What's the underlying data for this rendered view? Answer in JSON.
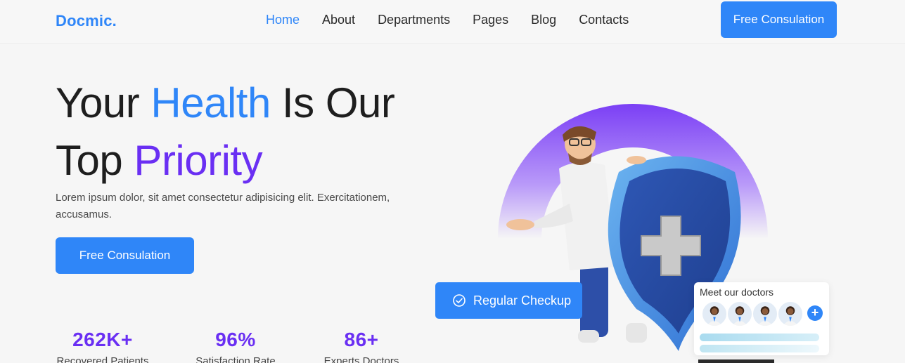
{
  "header": {
    "logo": "Docmic.",
    "nav": [
      "Home",
      "About",
      "Departments",
      "Pages",
      "Blog",
      "Contacts"
    ],
    "active_nav": "Home",
    "cta": "Free Consulation"
  },
  "hero": {
    "title_part1": "Your ",
    "title_highlight1": "Health",
    "title_part2": " Is Our",
    "title_part3": "Top ",
    "title_highlight2": "Priority",
    "description": "Lorem ipsum dolor, sit amet consectetur adipisicing elit. Exercitationem, accusamus.",
    "cta": "Free Consulation"
  },
  "stats": [
    {
      "value": "262K+",
      "label": "Recovered Patients"
    },
    {
      "value": "96%",
      "label": "Satisfaction Rate"
    },
    {
      "value": "86+",
      "label": "Experts Doctors"
    }
  ],
  "checkup_button": {
    "label": "Regular Checkup",
    "icon": "check-circle-icon"
  },
  "doctors_card": {
    "title": "Meet our doctors",
    "plus": "+"
  },
  "colors": {
    "primary": "#2f86f8",
    "accent": "#6a2ff3",
    "background": "#f6f6f6"
  }
}
